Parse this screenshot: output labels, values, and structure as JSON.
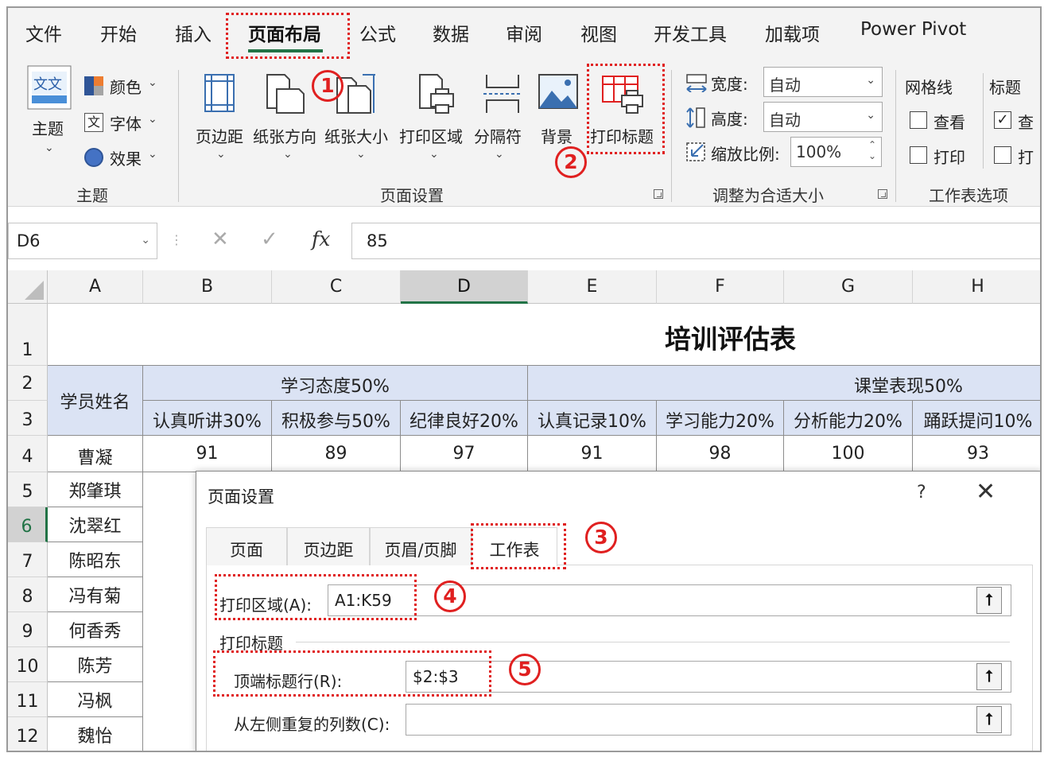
{
  "menu": {
    "tabs": [
      "文件",
      "开始",
      "插入",
      "页面布局",
      "公式",
      "数据",
      "审阅",
      "视图",
      "开发工具",
      "加载项",
      "Power Pivot"
    ]
  },
  "ribbon": {
    "theme_group": {
      "main_label": "主题",
      "theme_icon_text": "文文",
      "colors_label": "颜色",
      "fonts_label": "字体",
      "effects_label": "效果",
      "group_label": "主题"
    },
    "page_setup_group": {
      "buttons": [
        "页边距",
        "纸张方向",
        "纸张大小",
        "打印区域",
        "分隔符",
        "背景",
        "打印标题"
      ],
      "group_label": "页面设置"
    },
    "scale_group": {
      "width_label": "宽度:",
      "width_value": "自动",
      "height_label": "高度:",
      "height_value": "自动",
      "scale_label": "缩放比例:",
      "scale_value": "100%",
      "group_label": "调整为合适大小"
    },
    "sheet_options_group": {
      "gridlines_header": "网格线",
      "headings_header": "标题",
      "view_label": "查看",
      "view_label_2": "查",
      "print_label": "打印",
      "print_label_2": "打",
      "group_label": "工作表选项"
    }
  },
  "formula_bar": {
    "name_box": "D6",
    "fx": "fx",
    "formula": "85"
  },
  "sheet": {
    "columns": [
      "A",
      "B",
      "C",
      "D",
      "E",
      "F",
      "G",
      "H"
    ],
    "rows": [
      "1",
      "2",
      "3",
      "4",
      "5",
      "6",
      "7",
      "8",
      "9",
      "10",
      "11",
      "12"
    ],
    "title": "培训评估表",
    "header_name": "学员姓名",
    "group1": "学习态度50%",
    "group2": "课堂表现50%",
    "subheaders": [
      "认真听讲30%",
      "积极参与50%",
      "纪律良好20%",
      "认真记录10%",
      "学习能力20%",
      "分析能力20%",
      "踊跃提问10%"
    ],
    "row4": [
      "曹凝",
      "91",
      "89",
      "97",
      "91",
      "98",
      "100",
      "93"
    ],
    "names": [
      "郑肇琪",
      "沈翠红",
      "陈昭东",
      "冯有菊",
      "何香秀",
      "陈芳",
      "冯枫",
      "魏怡"
    ]
  },
  "dialog": {
    "title": "页面设置",
    "help": "?",
    "close": "✕",
    "tabs": [
      "页面",
      "页边距",
      "页眉/页脚",
      "工作表"
    ],
    "print_area_label": "打印区域(A):",
    "print_area_value": "A1:K59",
    "print_titles_section": "打印标题",
    "top_rows_label": "顶端标题行(R):",
    "top_rows_value": "$2:$3",
    "left_cols_label": "从左侧重复的列数(C):",
    "left_cols_value": "",
    "collapse_icon": "⭡"
  },
  "annotations": [
    "1",
    "2",
    "3",
    "4",
    "5"
  ],
  "colors": {
    "accent": "#217346",
    "annotation": "#e02020",
    "header_fill": "#dbe3f4"
  }
}
